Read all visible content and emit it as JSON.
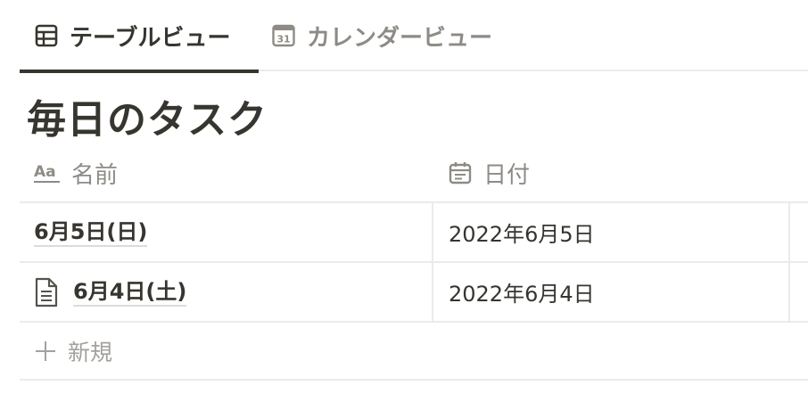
{
  "tabs": [
    {
      "label": "テーブルビュー",
      "icon": "table-icon",
      "active": true
    },
    {
      "label": "カレンダービュー",
      "icon": "calendar-icon",
      "calendar_day": "31",
      "active": false
    }
  ],
  "title": "毎日のタスク",
  "columns": [
    {
      "label": "名前",
      "icon": "text-property-icon",
      "icon_text": "Aa"
    },
    {
      "label": "日付",
      "icon": "date-property-icon"
    }
  ],
  "rows": [
    {
      "name": "6月5日(日)",
      "date": "2022年6月5日",
      "has_page_icon": false
    },
    {
      "name": "6月4日(土)",
      "date": "2022年6月4日",
      "has_page_icon": true
    }
  ],
  "new_label": "新規",
  "colors": {
    "text": "#37352f",
    "muted": "#8e8b86",
    "border": "#ebebea"
  }
}
